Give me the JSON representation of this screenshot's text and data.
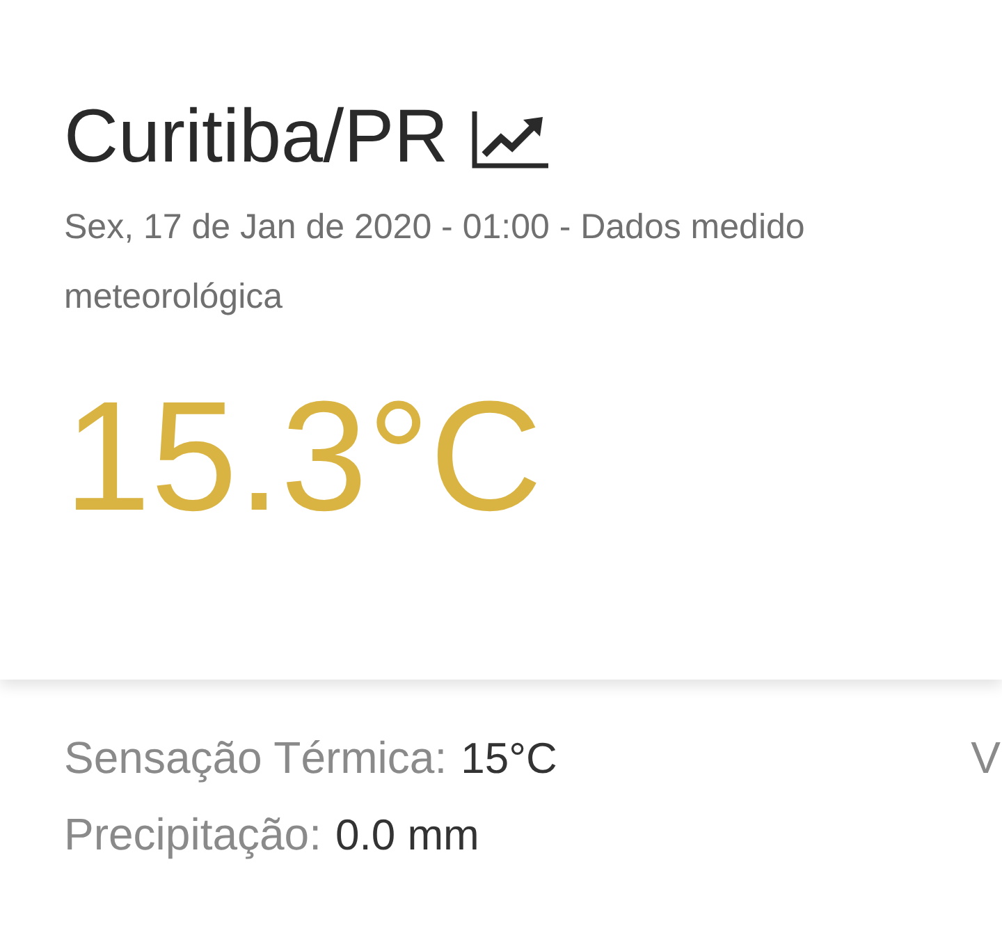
{
  "header": {
    "city": "Curitiba/PR",
    "subtitle_lines": [
      "Sex, 17 de Jan de 2020 - 01:00 - Dados medido",
      "meteorológica"
    ]
  },
  "temperature": "15.3°C",
  "details": {
    "rows": [
      {
        "label": "Sensação Térmica:",
        "value": "15°C"
      },
      {
        "label": "Precipitação:",
        "value": "0.0 mm"
      }
    ],
    "column_2_label": "V"
  }
}
